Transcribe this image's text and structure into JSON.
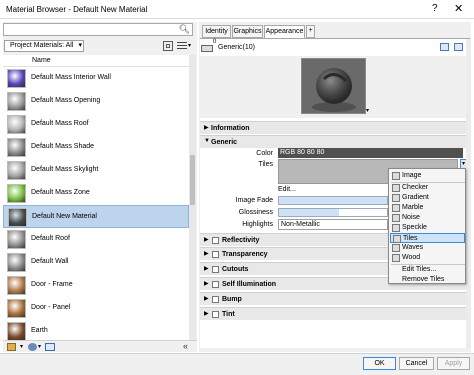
{
  "window": {
    "title": "Material Browser - Default New Material",
    "help_label": "?",
    "close_label": "✕"
  },
  "search": {
    "value": "",
    "placeholder": ""
  },
  "library": {
    "selector_label": "Project Materials: All",
    "column_header": "Name"
  },
  "materials": [
    {
      "label": "Default Mass Interior Wall",
      "color": "#5a43b8"
    },
    {
      "label": "Default Mass Opening",
      "color": "#9a9a9a"
    },
    {
      "label": "Default Mass Roof",
      "color": "#b5b5b5"
    },
    {
      "label": "Default Mass Shade",
      "color": "#8a8a8a"
    },
    {
      "label": "Default Mass Skylight",
      "color": "#a3a3a3"
    },
    {
      "label": "Default Mass Zone",
      "color": "#7ac043"
    },
    {
      "label": "Default New Material",
      "color": "#4a4a4a"
    },
    {
      "label": "Default Roof",
      "color": "#909090"
    },
    {
      "label": "Default Wall",
      "color": "#8c8c8c"
    },
    {
      "label": "Door - Frame",
      "color": "#b07a4a"
    },
    {
      "label": "Door - Panel",
      "color": "#a86e3a"
    },
    {
      "label": "Earth",
      "color": "#7a4a2a"
    }
  ],
  "tabs": [
    "Identity",
    "Graphics",
    "Appearance",
    "+"
  ],
  "asset": {
    "count": "0",
    "name": "Generic(10)"
  },
  "sections": {
    "information": "Information",
    "generic": "Generic",
    "reflectivity": "Reflectivity",
    "transparency": "Transparency",
    "cutouts": "Cutouts",
    "self_illumination": "Self Illumination",
    "bump": "Bump",
    "tint": "Tint"
  },
  "properties": {
    "color_label": "Color",
    "color_value": "RGB 80 80 80",
    "tiles_label": "Tiles",
    "edit_label": "Edit...",
    "image_fade_label": "Image Fade",
    "glossiness_label": "Glossiness",
    "highlights_label": "Highlights",
    "highlights_value": "Non-Metallic"
  },
  "popup_menu": {
    "items": [
      "Image",
      "Checker",
      "Gradient",
      "Marble",
      "Noise",
      "Speckle",
      "Tiles",
      "Waves",
      "Wood",
      "Edit Tiles...",
      "Remove Tiles"
    ],
    "highlighted": "Tiles"
  },
  "footer": {
    "ok": "OK",
    "cancel": "Cancel",
    "apply": "Apply"
  },
  "colors": {
    "selection": "#bcd4ec",
    "accent": "#3c8ad7"
  },
  "icons": [
    "search-icon",
    "chevron-down-icon",
    "grid-view-icon",
    "list-view-icon",
    "collapse-icon",
    "duplicate-icon",
    "swap-icon"
  ]
}
